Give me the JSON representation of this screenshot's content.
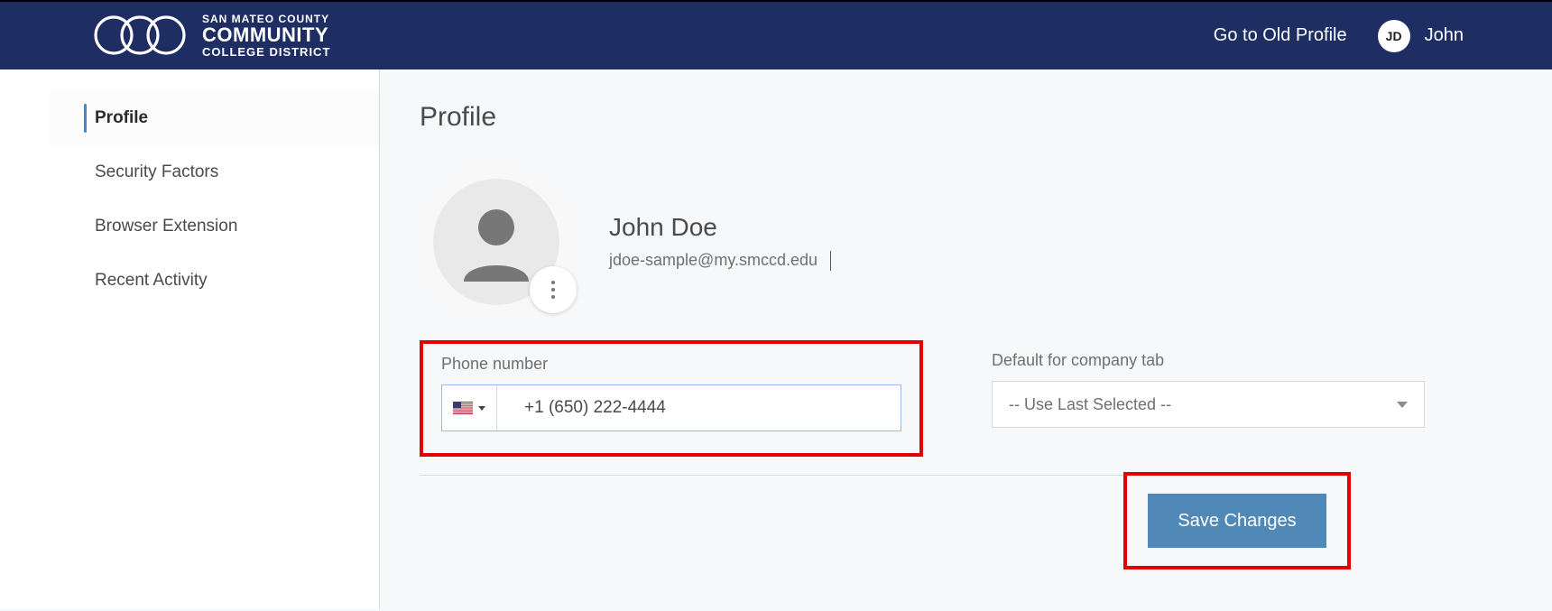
{
  "header": {
    "org_line1": "SAN MATEO COUNTY",
    "org_line2": "COMMUNITY",
    "org_line3": "COLLEGE DISTRICT",
    "old_profile_link": "Go to Old Profile",
    "avatar_initials": "JD",
    "avatar_name": "John"
  },
  "sidebar": {
    "items": [
      {
        "label": "Profile"
      },
      {
        "label": "Security Factors"
      },
      {
        "label": "Browser Extension"
      },
      {
        "label": "Recent Activity"
      }
    ]
  },
  "main": {
    "title": "Profile",
    "profile_name": "John Doe",
    "profile_email": "jdoe-sample@my.smccd.edu",
    "phone_label": "Phone number",
    "phone_value": "+1 (650) 222-4444",
    "phone_country": "US",
    "company_label": "Default for company tab",
    "company_value": "-- Use Last Selected --",
    "save_label": "Save Changes"
  },
  "icons": {
    "more": "more-vertical-icon",
    "person": "person-silhouette-icon",
    "flag_us": "us-flag-icon",
    "caret_down": "caret-down-icon",
    "chevron_down": "chevron-down-icon",
    "logo_rings": "interlocking-rings-icon"
  }
}
